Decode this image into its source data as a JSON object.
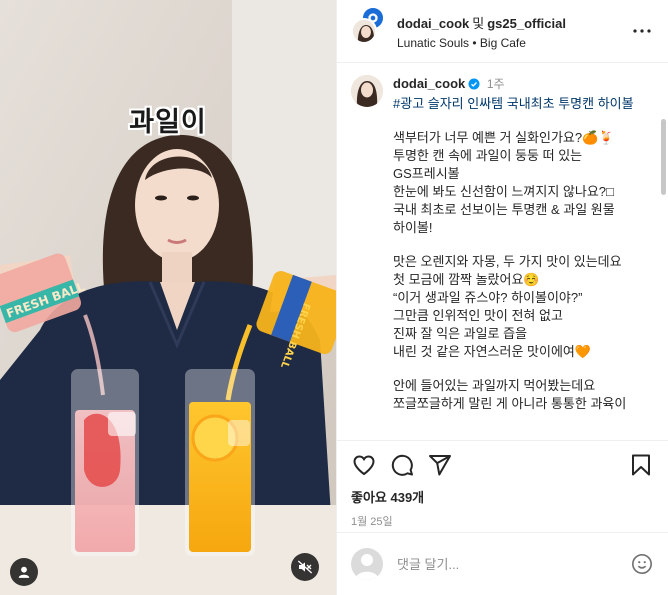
{
  "media": {
    "overlay_caption": "과일이",
    "can_brand_text": "FRESH BALL"
  },
  "header": {
    "account_primary": "dodai_cook",
    "and_word": "및",
    "account_secondary": "gs25_official",
    "audio_label": "Lunatic Souls • Big Cafe"
  },
  "caption": {
    "username": "dodai_cook",
    "time_ago": "1주",
    "lines": [
      {
        "text": "#광고 슬자리 인싸템 국내최초 투명캔 하이볼",
        "tag": true
      },
      {
        "text": "",
        "gap": true
      },
      {
        "text": "색부터가 너무 예쁜 거 실화인가요?🍊🍹"
      },
      {
        "text": "투명한 캔 속에 과일이 둥둥 떠 있는 GS프레시볼"
      },
      {
        "text": "한눈에 봐도 신선함이 느껴지지 않나요?□"
      },
      {
        "text": "국내 최초로 선보이는 투명캔 & 과일 원물 하이볼!"
      },
      {
        "text": "",
        "gap": true
      },
      {
        "text": "맛은 오렌지와 자몽, 두 가지 맛이 있는데요"
      },
      {
        "text": "첫 모금에 깜짝 놀랐어요☺️"
      },
      {
        "text": "“이거 생과일 쥬스야? 하이볼이야?”"
      },
      {
        "text": "그만큼 인위적인 맛이 전혀 없고"
      },
      {
        "text": "진짜 잘 익은 과일로 즙을"
      },
      {
        "text": "내린 것 같은 자연스러운 맛이에여🧡"
      },
      {
        "text": "",
        "gap": true
      },
      {
        "text": "안에 들어있는 과일까지 먹어봤는데요"
      },
      {
        "text": "쪼글쪼글하게 말린 게 아니라 통통한 과육이"
      }
    ]
  },
  "actions": {
    "likes": "좋아요 439개",
    "date": "1월 25일"
  },
  "comment_box": {
    "placeholder": "댓글 달기..."
  },
  "colors": {
    "link": "#00376b",
    "verified": "#0095f6",
    "muted": "#8e8e8e"
  },
  "icons": [
    "more-options-icon",
    "verified-badge-icon",
    "heart-icon",
    "comment-icon",
    "share-icon",
    "bookmark-icon",
    "emoji-icon",
    "user-tag-icon",
    "mute-icon"
  ]
}
